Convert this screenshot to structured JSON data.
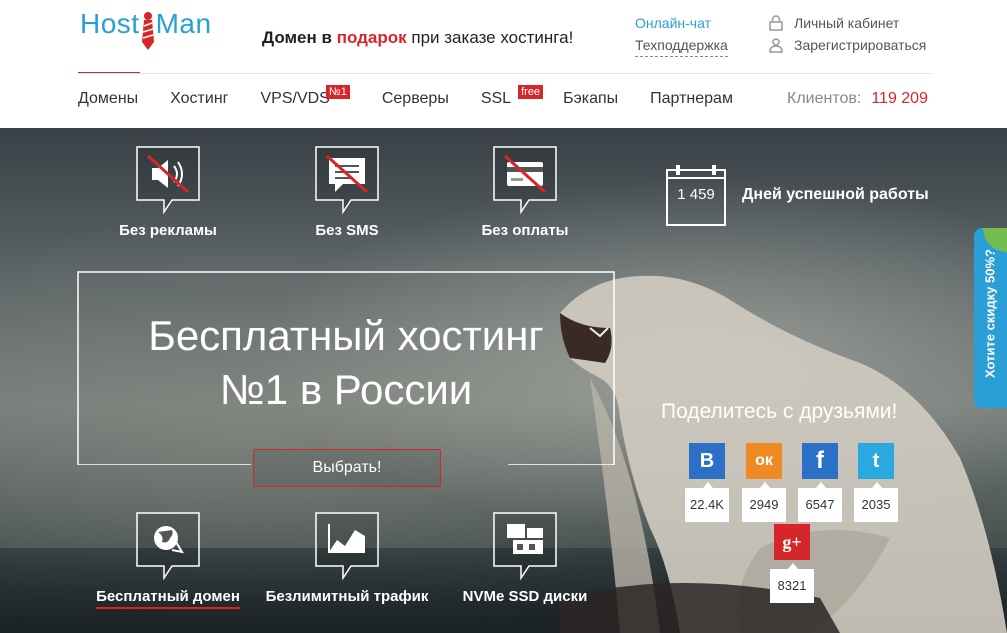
{
  "header": {
    "logo": {
      "left": "Host",
      "right": "Man"
    },
    "promo": {
      "part1": "Домен в",
      "highlight": "подарок",
      "part2": "при заказе хостинга!"
    },
    "links": {
      "chat": "Онлайн-чат",
      "support": "Техподдержка"
    },
    "account": {
      "login": "Личный кабинет",
      "register": "Зарегистрироваться"
    },
    "nav": [
      {
        "label": "Домены"
      },
      {
        "label": "Хостинг"
      },
      {
        "label": "VPS/VDS",
        "badge": "№1"
      },
      {
        "label": "Серверы"
      },
      {
        "label": "SSL",
        "badge": "free"
      },
      {
        "label": "Бэкапы"
      },
      {
        "label": "Партнерам"
      }
    ],
    "clients": {
      "label": "Клиентов:",
      "count": "119 209"
    }
  },
  "hero": {
    "features_top": [
      {
        "label": "Без рекламы",
        "icon": "no-ads-speaker-icon"
      },
      {
        "label": "Без SMS",
        "icon": "no-sms-icon"
      },
      {
        "label": "Без оплаты",
        "icon": "no-payment-card-icon"
      }
    ],
    "days": {
      "count": "1 459",
      "label": "Дней успешной работы"
    },
    "title_line1": "Бесплатный хостинг",
    "title_line2": "№1 в России",
    "choose_button": "Выбрать!",
    "features_bottom": [
      {
        "label": "Бесплатный домен",
        "icon": "globe-icon"
      },
      {
        "label": "Безлимитный трафик",
        "icon": "traffic-chart-icon"
      },
      {
        "label": "NVMe SSD диски",
        "icon": "ssd-disk-icon"
      }
    ],
    "share_title": "Поделитесь с друзьями!",
    "social": [
      {
        "name": "vk",
        "glyph": "B",
        "count": "22.4K",
        "color": "#2c6fc7"
      },
      {
        "name": "odnoklassniki",
        "glyph": "ок",
        "count": "2949",
        "color": "#f08a24"
      },
      {
        "name": "facebook",
        "glyph": "f",
        "count": "6547",
        "color": "#2c6fc7"
      },
      {
        "name": "twitter",
        "glyph": "t",
        "count": "2035",
        "color": "#2aa9e0"
      },
      {
        "name": "google-plus",
        "glyph": "g+",
        "count": "8321",
        "color": "#d6262a"
      }
    ],
    "side_tab": "Хотите скидку 50%?"
  },
  "colors": {
    "accent": "#d6262a",
    "brand": "#2a9fd6"
  }
}
